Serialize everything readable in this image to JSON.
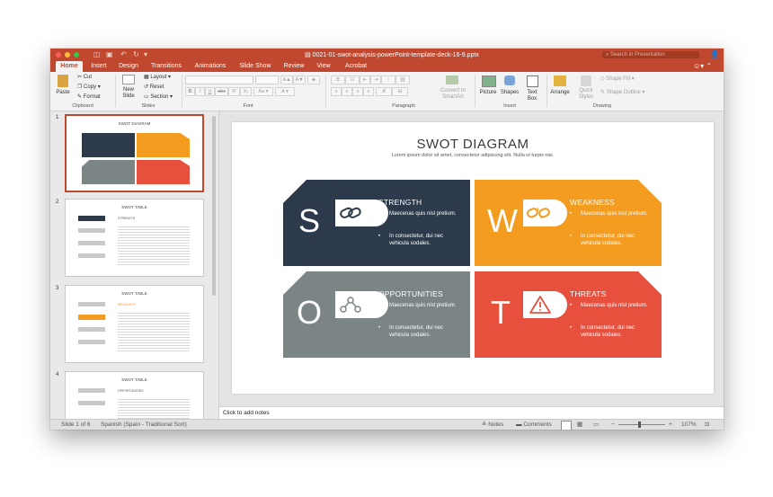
{
  "window": {
    "doc_title": "0021-01-swot-analysis-powerPoint-template-deck-16-9.pptx",
    "search_placeholder": "Search in Presentation"
  },
  "tabs": [
    "Home",
    "Insert",
    "Design",
    "Transitions",
    "Animations",
    "Slide Show",
    "Review",
    "View",
    "Acrobat"
  ],
  "ribbon": {
    "clipboard": {
      "paste": "Paste",
      "cut": "Cut",
      "copy": "Copy",
      "format": "Format",
      "group": "Clipboard"
    },
    "slides": {
      "new_slide_1": "New",
      "new_slide_2": "Slide",
      "layout": "Layout",
      "reset": "Reset",
      "section": "Section",
      "group": "Slides"
    },
    "font": {
      "group": "Font",
      "bold": "B",
      "italic": "I",
      "underline": "U",
      "strike": "abc",
      "superscript": "X²",
      "subscript": "X₂",
      "grow": "A▲",
      "shrink": "A▼"
    },
    "paragraph": {
      "group": "Paragraph",
      "convert_1": "Convert to",
      "convert_2": "SmartArt"
    },
    "insert": {
      "picture": "Picture",
      "shapes": "Shapes",
      "textbox_1": "Text",
      "textbox_2": "Box",
      "group": "Insert"
    },
    "drawing": {
      "arrange": "Arrange",
      "quick_1": "Quick",
      "quick_2": "Styles",
      "shape_fill": "Shape Fill",
      "shape_outline": "Shape Outline",
      "group": "Drawing"
    }
  },
  "thumbnails": [
    {
      "num": "1",
      "title": "SWOT DIAGRAM"
    },
    {
      "num": "2",
      "title": "SWOT TABLE",
      "heading": "STRENGTH"
    },
    {
      "num": "3",
      "title": "SWOT TABLE",
      "heading": "WEAKNESS"
    },
    {
      "num": "4",
      "title": "SWOT TABLE",
      "heading": "OPPORTUNITIES"
    }
  ],
  "slide": {
    "title": "SWOT DIAGRAM",
    "subtitle": "Lorem ipsum dolor sit amet, consectetur adipiscing elit. Nulla ut turpis nisi.",
    "quadrants": [
      {
        "letter": "S",
        "heading": "STRENGTH",
        "color": "#2c3a4b",
        "bullet1": "Maecenas quis nisl pretium.",
        "bullet2": "In consectetur, dui nec vehicula sodales.",
        "icon": "link-icon"
      },
      {
        "letter": "W",
        "heading": "WEAKNESS",
        "color": "#f39c1f",
        "bullet1": "Maecenas quis nisl pretium.",
        "bullet2": "In consectetur, dui nec vehicula sodales.",
        "icon": "broken-link-icon"
      },
      {
        "letter": "O",
        "heading": "OPPORTUNITIES",
        "color": "#7c8586",
        "bullet1": "Maecenas quis nisl pretium.",
        "bullet2": "In consectetur, dui nec vehicula sodales.",
        "icon": "network-icon"
      },
      {
        "letter": "T",
        "heading": "THREATS",
        "color": "#e8503e",
        "bullet1": "Maecenas quis nisl pretium.",
        "bullet2": "In consectetur, dui nec vehicula sodales.",
        "icon": "warning-icon"
      }
    ]
  },
  "notes_placeholder": "Click to add notes",
  "status": {
    "slide_of": "Slide 1 of 6",
    "language": "Spanish (Spain - Traditional Sort)",
    "notes": "Notes",
    "comments": "Comments",
    "zoom": "107%"
  },
  "colors": {
    "accent": "#c0482e"
  }
}
